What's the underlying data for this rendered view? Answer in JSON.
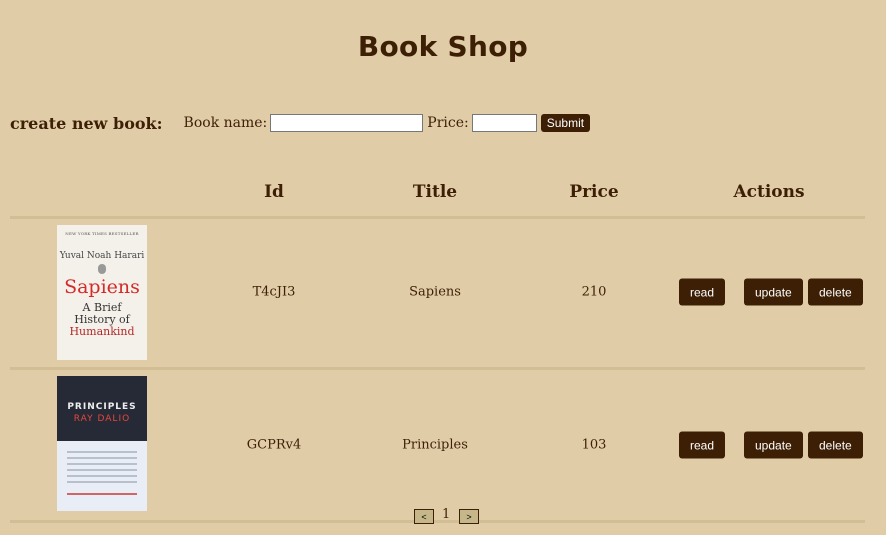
{
  "page": {
    "title": "Book Shop"
  },
  "create_form": {
    "label": "create new book:",
    "name_label": "Book name:",
    "name_value": "",
    "price_label": "Price:",
    "price_value": "",
    "submit_label": "Submit"
  },
  "table": {
    "headers": {
      "id": "Id",
      "title": "Title",
      "price": "Price",
      "actions": "Actions"
    },
    "rows": [
      {
        "id": "T4cJI3",
        "title": "Sapiens",
        "price": "210",
        "cover": {
          "top_line": "NEW YORK TIMES BESTSELLER",
          "author": "Yuval Noah Harari",
          "main": "Sapiens",
          "sub1": "A Brief",
          "sub2": "History of",
          "sub3": "Humankind"
        }
      },
      {
        "id": "GCPRv4",
        "title": "Principles",
        "price": "103",
        "cover": {
          "main": "PRINCIPLES",
          "author": "RAY DALIO"
        }
      }
    ],
    "actions": {
      "read": "read",
      "update": "update",
      "delete": "delete"
    }
  },
  "pagination": {
    "prev": "<",
    "current": "1",
    "next": ">"
  }
}
